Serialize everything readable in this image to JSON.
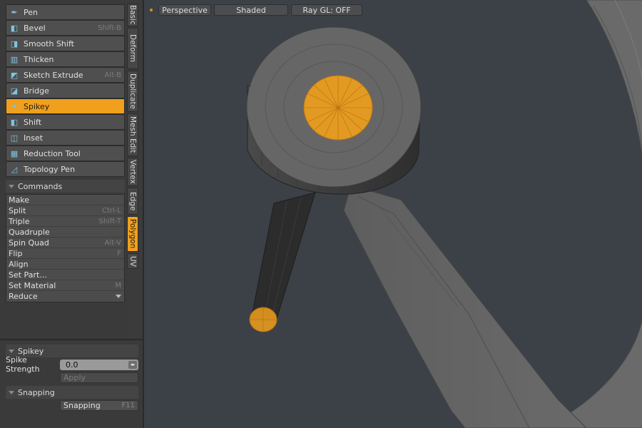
{
  "tools": [
    {
      "label": "Pen",
      "shortcut": "",
      "icon": "pen-icon",
      "active": false
    },
    {
      "label": "Bevel",
      "shortcut": "Shift-B",
      "icon": "bevel-icon",
      "active": false
    },
    {
      "label": "Smooth Shift",
      "shortcut": "",
      "icon": "smooth-shift-icon",
      "active": false
    },
    {
      "label": "Thicken",
      "shortcut": "",
      "icon": "thicken-icon",
      "active": false
    },
    {
      "label": "Sketch Extrude",
      "shortcut": "Alt-B",
      "icon": "sketch-extrude-icon",
      "active": false
    },
    {
      "label": "Bridge",
      "shortcut": "",
      "icon": "bridge-icon",
      "active": false
    },
    {
      "label": "Spikey",
      "shortcut": "",
      "icon": "spikey-icon",
      "active": true
    },
    {
      "label": "Shift",
      "shortcut": "",
      "icon": "shift-icon",
      "active": false
    },
    {
      "label": "Inset",
      "shortcut": "",
      "icon": "inset-icon",
      "active": false
    },
    {
      "label": "Reduction Tool",
      "shortcut": "",
      "icon": "reduction-tool-icon",
      "active": false
    },
    {
      "label": "Topology Pen",
      "shortcut": "",
      "icon": "topology-pen-icon",
      "active": false
    }
  ],
  "commands": {
    "title": "Commands",
    "items": [
      {
        "label": "Make",
        "shortcut": ""
      },
      {
        "label": "Split",
        "shortcut": "Ctrl-L"
      },
      {
        "label": "Triple",
        "shortcut": "Shift-T"
      },
      {
        "label": "Quadruple",
        "shortcut": ""
      },
      {
        "label": "Spin Quad",
        "shortcut": "Alt-V"
      },
      {
        "label": "Flip",
        "shortcut": "F"
      },
      {
        "label": "Align",
        "shortcut": ""
      },
      {
        "label": "Set Part...",
        "shortcut": ""
      },
      {
        "label": "Set Material",
        "shortcut": "M"
      },
      {
        "label": "Reduce",
        "shortcut": "",
        "dropdown": true
      }
    ]
  },
  "tabs": [
    {
      "label": "Basic",
      "active": false
    },
    {
      "label": "Deform",
      "active": false
    },
    {
      "label": "Duplicate",
      "active": false
    },
    {
      "label": "Mesh Edit",
      "active": false
    },
    {
      "label": "Vertex",
      "active": false
    },
    {
      "label": "Edge",
      "active": false
    },
    {
      "label": "Polygon",
      "active": true
    },
    {
      "label": "UV",
      "active": false
    }
  ],
  "properties": {
    "spikey_title": "Spikey",
    "spike_strength_label": "Spike Strength",
    "spike_strength_value": "0.0",
    "apply_label": "Apply",
    "snapping_title": "Snapping",
    "snapping_label": "Snapping",
    "snapping_shortcut": "F11"
  },
  "viewport": {
    "view": "Perspective",
    "shading": "Shaded",
    "raygl": "Ray GL: OFF"
  },
  "colors": {
    "accent": "#f0a01c",
    "viewport_bg": "#3c4148",
    "mesh": "#5a5a5a"
  }
}
